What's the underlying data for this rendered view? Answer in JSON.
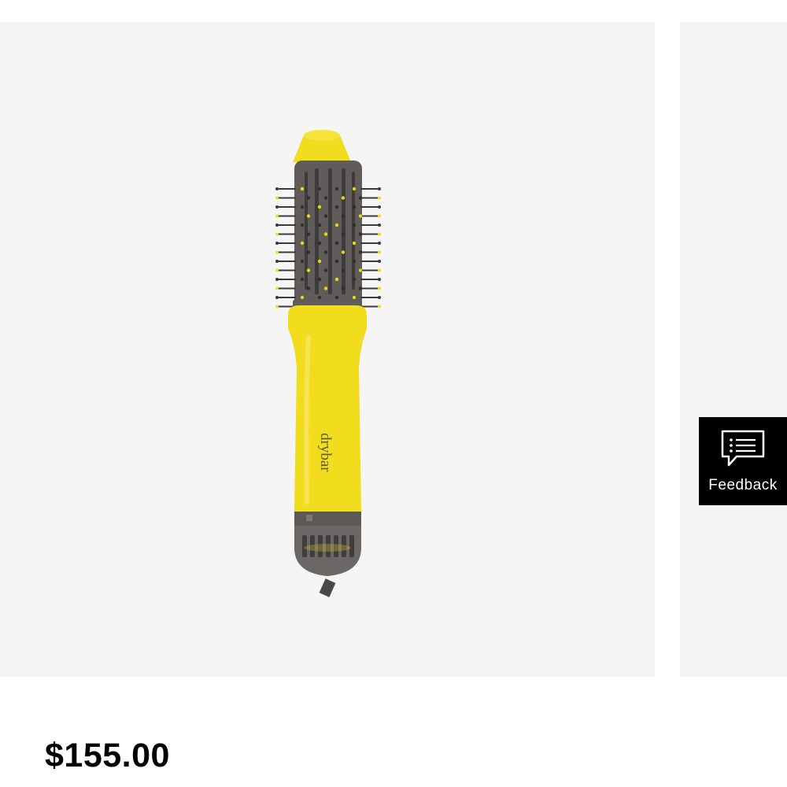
{
  "product": {
    "brand_mark": "drybar",
    "price": "$155.00"
  },
  "feedback": {
    "label": "Feedback",
    "icon": "feedback-chat-icon"
  },
  "colors": {
    "image_background": "#f5f5f5",
    "brush_yellow": "#f2dc1e",
    "brush_gray": "#5f5c59",
    "feedback_background": "#000000"
  }
}
